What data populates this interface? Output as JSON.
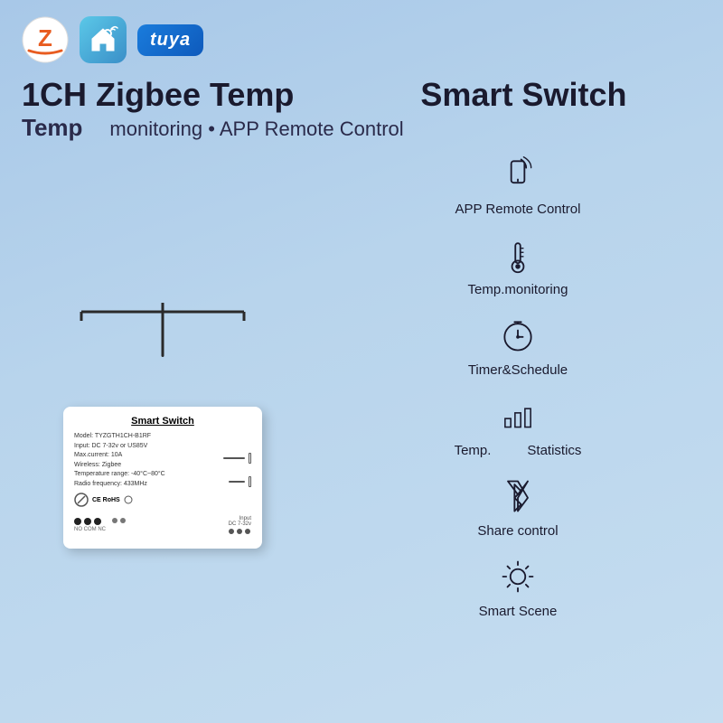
{
  "logos": {
    "tuya_text": "tuya"
  },
  "header": {
    "line1_left": "1CH Zigbee Temp",
    "line1_right": "Smart Switch",
    "line2_left": "Temp",
    "line2_middle": "monitoring • APP Remote Control"
  },
  "device": {
    "title": "Smart Switch",
    "specs": [
      "Model: TYZGTH1CH-B1RF",
      "Input: DC 7-32v or US85V",
      "Max.current: 10A",
      "Wireless: Zigbee",
      "Temperature range: -40°C~80°C",
      "Radio frequency: 433MHz"
    ],
    "bottom_label": "Input",
    "bottom_voltage": "DC 7-32v"
  },
  "features": [
    {
      "id": "app-remote",
      "label": "APP Remote Control",
      "icon": "phone-signal"
    },
    {
      "id": "temp-monitoring",
      "label": "Temp.monitoring",
      "icon": "thermometer"
    },
    {
      "id": "timer-schedule",
      "label": "Timer&Schedule",
      "icon": "timer"
    },
    {
      "id": "temp-stats",
      "label_left": "Temp.",
      "label_right": "Statistics",
      "icon": "bar-chart",
      "type": "pair"
    },
    {
      "id": "share-control",
      "label": "Share control",
      "icon": "bluetooth-home"
    },
    {
      "id": "smart-scene",
      "label": "Smart Scene",
      "icon": "sun"
    }
  ]
}
